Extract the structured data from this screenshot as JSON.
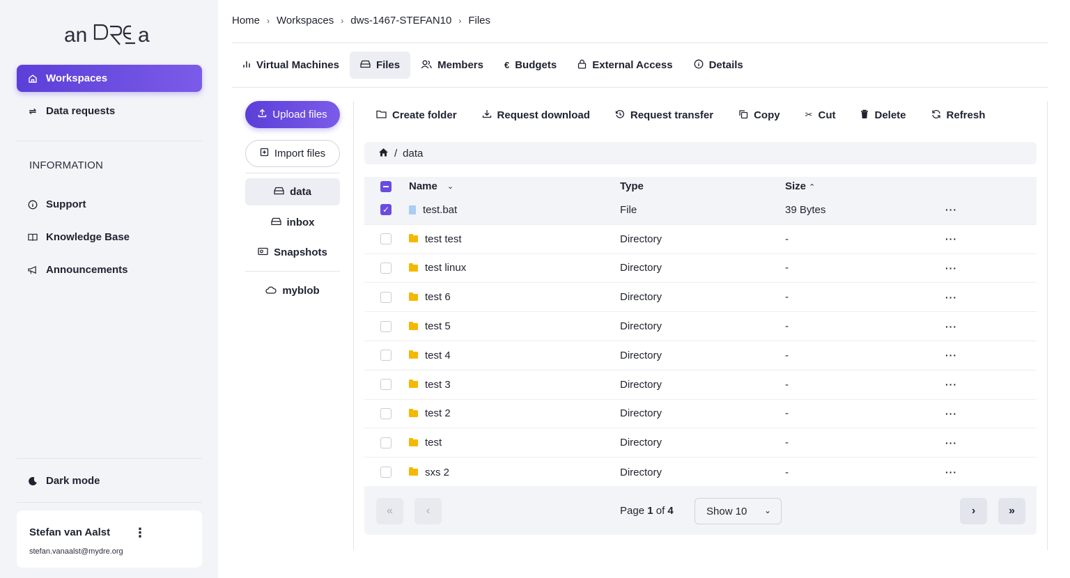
{
  "brand": {
    "logo_text": "anDRE"
  },
  "sidebar": {
    "nav": [
      {
        "label": "Workspaces",
        "icon": "home-icon",
        "active": true
      },
      {
        "label": "Data requests",
        "icon": "arrows-exchange-icon",
        "active": false
      }
    ],
    "info_section_label": "INFORMATION",
    "info_items": [
      {
        "label": "Support",
        "icon": "info-circle-icon"
      },
      {
        "label": "Knowledge Base",
        "icon": "book-icon"
      },
      {
        "label": "Announcements",
        "icon": "megaphone-icon"
      }
    ],
    "dark_mode_label": "Dark mode",
    "user": {
      "name": "Stefan van Aalst",
      "email": "stefan.vanaalst@mydre.org"
    }
  },
  "breadcrumb": [
    "Home",
    "Workspaces",
    "dws-1467-STEFAN10",
    "Files"
  ],
  "tabs": [
    {
      "label": "Virtual Machines",
      "icon": "bar-chart-icon",
      "active": false
    },
    {
      "label": "Files",
      "icon": "drive-icon",
      "active": true
    },
    {
      "label": "Members",
      "icon": "users-icon",
      "active": false
    },
    {
      "label": "Budgets",
      "icon": "euro-icon",
      "active": false
    },
    {
      "label": "External Access",
      "icon": "lock-icon",
      "active": false
    },
    {
      "label": "Details",
      "icon": "info-circle-icon",
      "active": false
    }
  ],
  "file_panel": {
    "upload_label": "Upload files",
    "import_label": "Import files",
    "storages": [
      {
        "label": "data",
        "active": true
      },
      {
        "label": "inbox",
        "active": false
      },
      {
        "label": "Snapshots",
        "active": false
      },
      {
        "label": "myblob",
        "active": false
      }
    ]
  },
  "actions": [
    {
      "label": "Create folder",
      "icon": "folder-icon"
    },
    {
      "label": "Request download",
      "icon": "download-icon"
    },
    {
      "label": "Request transfer",
      "icon": "history-icon"
    },
    {
      "label": "Copy",
      "icon": "copy-icon"
    },
    {
      "label": "Cut",
      "icon": "scissors-icon"
    },
    {
      "label": "Delete",
      "icon": "trash-icon"
    },
    {
      "label": "Refresh",
      "icon": "refresh-icon"
    }
  ],
  "path": {
    "separator": "/",
    "current": "data"
  },
  "table": {
    "columns": {
      "name": "Name",
      "type": "Type",
      "size": "Size"
    },
    "rows": [
      {
        "name": "test.bat",
        "type": "File",
        "size": "39 Bytes",
        "kind": "file",
        "checked": true
      },
      {
        "name": "test test",
        "type": "Directory",
        "size": "-",
        "kind": "folder",
        "checked": false
      },
      {
        "name": "test linux",
        "type": "Directory",
        "size": "-",
        "kind": "folder",
        "checked": false
      },
      {
        "name": "test 6",
        "type": "Directory",
        "size": "-",
        "kind": "folder",
        "checked": false
      },
      {
        "name": "test 5",
        "type": "Directory",
        "size": "-",
        "kind": "folder",
        "checked": false
      },
      {
        "name": "test 4",
        "type": "Directory",
        "size": "-",
        "kind": "folder",
        "checked": false
      },
      {
        "name": "test 3",
        "type": "Directory",
        "size": "-",
        "kind": "folder",
        "checked": false
      },
      {
        "name": "test 2",
        "type": "Directory",
        "size": "-",
        "kind": "folder",
        "checked": false
      },
      {
        "name": "test",
        "type": "Directory",
        "size": "-",
        "kind": "folder",
        "checked": false
      },
      {
        "name": "sxs 2",
        "type": "Directory",
        "size": "-",
        "kind": "folder",
        "checked": false
      }
    ],
    "more_label": "···"
  },
  "pagination": {
    "page_prefix": "Page",
    "current_page": "1",
    "of_label": "of",
    "total_pages": "4",
    "show_label": "Show 10"
  },
  "colors": {
    "accent": "#6a4be0",
    "folder": "#f5b800",
    "sidebar_bg": "#f3f4f8"
  }
}
